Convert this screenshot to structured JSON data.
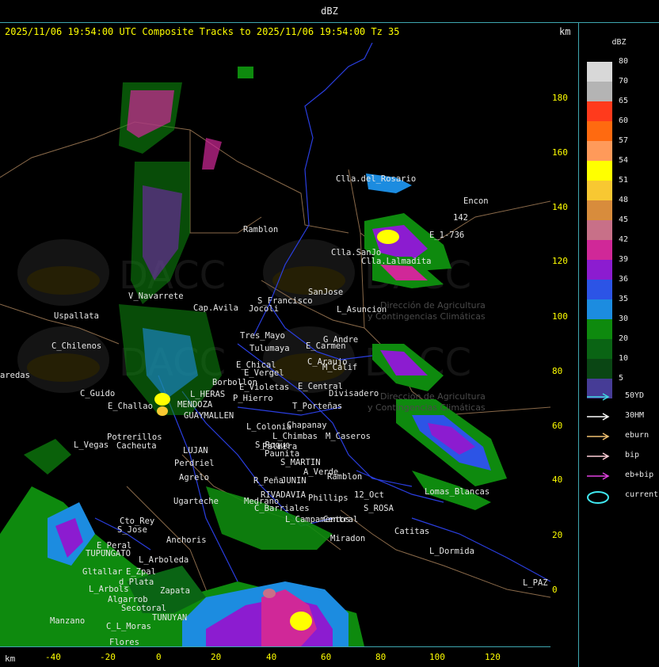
{
  "header": {
    "title": "dBZ",
    "subtitle": "2025/11/06 19:54:00 UTC Composite Tracks to 2025/11/06 19:54:00 Tz 35",
    "km_top": "km",
    "km_bottom": "km"
  },
  "axes": {
    "y_ticks": [
      "180",
      "160",
      "140",
      "120",
      "100",
      "80",
      "60",
      "40",
      "20",
      "0"
    ],
    "x_ticks": [
      "-40",
      "-20",
      "0",
      "20",
      "40",
      "60",
      "80",
      "100",
      "120"
    ]
  },
  "legend": {
    "title": "dBZ",
    "levels": [
      {
        "label": "80",
        "color": "#d8d8d8"
      },
      {
        "label": "70",
        "color": "#b4b4b4"
      },
      {
        "label": "65",
        "color": "#ff3a1c"
      },
      {
        "label": "60",
        "color": "#ff6a10"
      },
      {
        "label": "57",
        "color": "#ff9a5a"
      },
      {
        "label": "54",
        "color": "#ffff00"
      },
      {
        "label": "51",
        "color": "#f8c832"
      },
      {
        "label": "48",
        "color": "#d88c3c"
      },
      {
        "label": "45",
        "color": "#c87088"
      },
      {
        "label": "42",
        "color": "#d02898"
      },
      {
        "label": "39",
        "color": "#8c1cd0"
      },
      {
        "label": "36",
        "color": "#2c54e6"
      },
      {
        "label": "35",
        "color": "#1c8ce0"
      },
      {
        "label": "30",
        "color": "#0e8a0e"
      },
      {
        "label": "20",
        "color": "#0a6414"
      },
      {
        "label": "10",
        "color": "#0a4614"
      },
      {
        "label": "5",
        "color": "#463c96"
      }
    ],
    "tracks": [
      {
        "label": "50YD",
        "color": "#40d8e0"
      },
      {
        "label": "30HM",
        "color": "#ffffff"
      },
      {
        "label": "eburn",
        "color": "#f0c070"
      },
      {
        "label": "bip",
        "color": "#ffd0d8"
      },
      {
        "label": "eb+bip",
        "color": "#e040e0"
      },
      {
        "label": "current",
        "color": "#40e8f0"
      }
    ]
  },
  "places": [
    {
      "name": "Clla.del_Rosario"
    },
    {
      "name": "Encon"
    },
    {
      "name": "142"
    },
    {
      "name": "E_1-736"
    },
    {
      "name": "Ramblon"
    },
    {
      "name": "Clla.SanJo"
    },
    {
      "name": "Clla.Lalmadita"
    },
    {
      "name": "S_Francisco"
    },
    {
      "name": "SanJose"
    },
    {
      "name": "L_Asuncion"
    },
    {
      "name": "V_Navarrete"
    },
    {
      "name": "Cap.Avila"
    },
    {
      "name": "Jocoli"
    },
    {
      "name": "Uspallata"
    },
    {
      "name": "Tres_Mayo"
    },
    {
      "name": "G_Andre"
    },
    {
      "name": "E_Carmen"
    },
    {
      "name": "Tulumaya"
    },
    {
      "name": "C_Chilenos"
    },
    {
      "name": "E_Chical"
    },
    {
      "name": "C_Araujo"
    },
    {
      "name": "M_Calif"
    },
    {
      "name": "E_Vergel"
    },
    {
      "name": "Borbollon"
    },
    {
      "name": "E_Violetas"
    },
    {
      "name": "E_Central"
    },
    {
      "name": "Divisadero"
    },
    {
      "name": "aredas"
    },
    {
      "name": "C_Guido"
    },
    {
      "name": "L_HERAS"
    },
    {
      "name": "P_Hierro"
    },
    {
      "name": "E_Challao"
    },
    {
      "name": "MENDOZA"
    },
    {
      "name": "T_Porteñas"
    },
    {
      "name": "GUAYMALLEN"
    },
    {
      "name": "Chapanay"
    },
    {
      "name": "L_Colonia"
    },
    {
      "name": "Palmira"
    },
    {
      "name": "L_Chimbas"
    },
    {
      "name": "M_Caseros"
    },
    {
      "name": "Potrerillos"
    },
    {
      "name": "L_Vegas"
    },
    {
      "name": "Cacheuta"
    },
    {
      "name": "LUJAN"
    },
    {
      "name": "S_Roque"
    },
    {
      "name": "Paunita"
    },
    {
      "name": "Perdriel"
    },
    {
      "name": "S_MARTIN"
    },
    {
      "name": "Agrelo"
    },
    {
      "name": "A_Verde"
    },
    {
      "name": "Ramblon"
    },
    {
      "name": "R_Peña"
    },
    {
      "name": "JUNIN"
    },
    {
      "name": "Ugarteche"
    },
    {
      "name": "12_Oct"
    },
    {
      "name": "Lomas_Blancas"
    },
    {
      "name": "RIVADAVIA"
    },
    {
      "name": "Phillips"
    },
    {
      "name": "Medrano"
    },
    {
      "name": "S_ROSA"
    },
    {
      "name": "C_Barriales"
    },
    {
      "name": "L_Campamentos"
    },
    {
      "name": "Central"
    },
    {
      "name": "Cto_Rey"
    },
    {
      "name": "S_Jose"
    },
    {
      "name": "Catitas"
    },
    {
      "name": "Anchoris"
    },
    {
      "name": "E_Peral"
    },
    {
      "name": "TUPUNGATO"
    },
    {
      "name": "Miradon"
    },
    {
      "name": "L_Arboleda"
    },
    {
      "name": "L_Dormida"
    },
    {
      "name": "Gltallar"
    },
    {
      "name": "E_Zpal"
    },
    {
      "name": "L_Arbols"
    },
    {
      "name": "d_Plata"
    },
    {
      "name": "Zapata"
    },
    {
      "name": "L_PAZ"
    },
    {
      "name": "Algarrob"
    },
    {
      "name": "Secotoral"
    },
    {
      "name": "TUNUYAN"
    },
    {
      "name": "Manzano"
    },
    {
      "name": "C_L_Moras"
    },
    {
      "name": "Flores"
    }
  ],
  "watermarks": [
    {
      "line1": "Dirección de Agricultura",
      "line2": "y Contingencias Climáticas"
    },
    {
      "line1": "Dirección de Agricultura",
      "line2": "y Contingencias Climáticas"
    }
  ]
}
